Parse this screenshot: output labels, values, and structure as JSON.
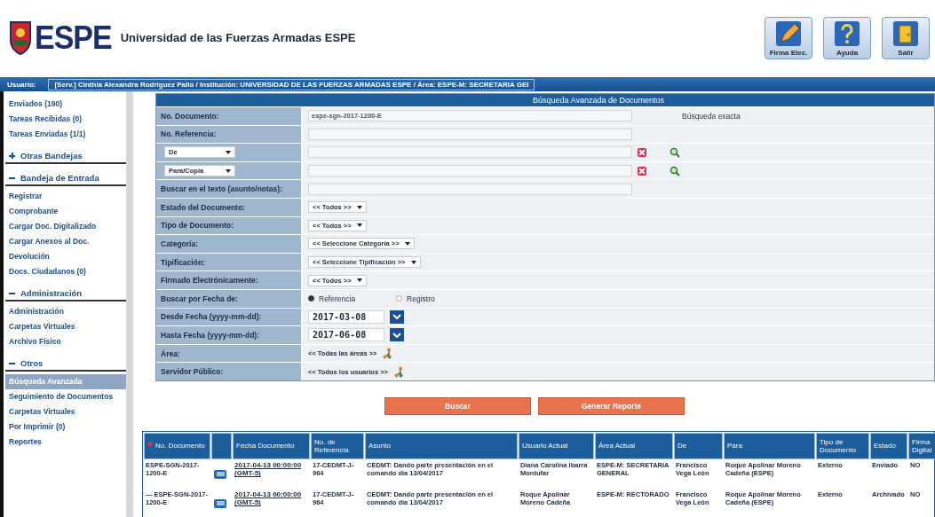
{
  "header": {
    "logo_text": "ESPE",
    "title": "Universidad de las Fuerzas Armadas ESPE",
    "buttons": [
      {
        "kind": "pencil",
        "label": "Firma Elec."
      },
      {
        "kind": "help",
        "label": "Ayuda"
      },
      {
        "kind": "exit",
        "label": "Salir"
      }
    ]
  },
  "user_bar": {
    "label": "Usuario:",
    "text": "[Serv.] Cinthia Alexandra Rodriguez Pallo / Institución: UNIVERSIDAD DE LAS FUERZAS ARMADAS ESPE / Área: ESPE-M: SECRETARIA GEI"
  },
  "sidebar": {
    "items": [
      {
        "label": "Enviados (190)",
        "selected": false
      },
      {
        "label": "Tareas Recibidas (0)",
        "selected": false
      },
      {
        "label": "Tareas Enviadas (1/1)",
        "selected": false
      }
    ],
    "sections": [
      {
        "title": "Otras Bandejas",
        "expanded": false
      },
      {
        "title": "Bandeja de Entrada",
        "expanded": true,
        "items": [
          {
            "label": "Registrar",
            "selected": false
          },
          {
            "label": "Comprobante",
            "selected": false
          },
          {
            "label": "Cargar Doc. Digitalizado",
            "selected": false
          },
          {
            "label": "Cargar Anexos al Doc.",
            "selected": false
          },
          {
            "label": "Devolución",
            "selected": false
          },
          {
            "label": "Docs. Ciudadanos (0)",
            "selected": false
          }
        ]
      },
      {
        "title": "Administración",
        "expanded": true,
        "items": [
          {
            "label": "Administración",
            "selected": false
          },
          {
            "label": "Carpetas Virtuales",
            "selected": false
          },
          {
            "label": "Archivo Físico",
            "selected": false
          }
        ]
      },
      {
        "title": "Otros",
        "expanded": true,
        "items": [
          {
            "label": "Búsqueda Avanzada",
            "selected": true
          },
          {
            "label": "Seguimiento de Documentos",
            "selected": false
          },
          {
            "label": "Carpetas Virtuales",
            "selected": false
          },
          {
            "label": "Por Imprimir (0)",
            "selected": false
          },
          {
            "label": "Reportes",
            "selected": false
          }
        ]
      }
    ]
  },
  "form": {
    "title": "Búsqueda Avanzada de Documentos",
    "rows": [
      {
        "kind": "text",
        "label": "No. Documento:",
        "value": "espe-sgn-2017-1200-E",
        "note": "Búsqueda exacta"
      },
      {
        "kind": "text",
        "label": "No. Referencia:"
      },
      {
        "kind": "picker",
        "label": "De"
      },
      {
        "kind": "picker",
        "label": "Para/Copia"
      },
      {
        "kind": "text",
        "label": "Buscar en el texto (asunto/notas):"
      },
      {
        "kind": "select",
        "label": "Estado del Documento:",
        "value": "<< Todos >>"
      },
      {
        "kind": "select",
        "label": "Tipo de Documento:",
        "value": "<< Todos >>"
      },
      {
        "kind": "select",
        "label": "Categoría:",
        "value": "<< Seleccione Categoría >>"
      },
      {
        "kind": "select",
        "label": "Tipificación:",
        "value": "<< Seleccione Tipificación >>"
      },
      {
        "kind": "select",
        "label": "Firmado Electrónicamente:",
        "value": "<< Todos >>"
      },
      {
        "kind": "radio",
        "label": "Buscar por Fecha de:",
        "options": [
          {
            "label": "Referencia",
            "selected": true
          },
          {
            "label": "Registro",
            "selected": false
          }
        ]
      },
      {
        "kind": "date",
        "label": "Desde Fecha (yyyy-mm-dd):",
        "value": "2017-03-08"
      },
      {
        "kind": "date",
        "label": "Hasta Fecha (yyyy-mm-dd):",
        "value": "2017-06-08"
      },
      {
        "kind": "tree",
        "label": "Área:",
        "value": "<< Todas las áreas >>"
      },
      {
        "kind": "tree",
        "label": "Servidor Público:",
        "value": "<< Todos los usuarios >>"
      }
    ],
    "buttons": [
      "Buscar",
      "Generar Reporte"
    ]
  },
  "table": {
    "columns": [
      "No. Documento",
      "Fecha Documento",
      "No. de Referencia",
      "Asunto",
      "Usuario Actual",
      "Área Actual",
      "De",
      "Para",
      "Tipo de Documento",
      "Estado",
      "Firma Digital"
    ],
    "rows": [
      {
        "cells": [
          "ESPE-SGN-2017-1200-E",
          "2017-04-13 00:00:00 (GMT-5)",
          "17-CEDMT-J-964",
          "CEDMT: Dando parte presentación en el comando día 13/04/2017",
          "Diana Carolina Ibarra Montufar",
          "ESPE-M: SECRETARIA GENERAL",
          "Francisco Vega León",
          "Roque Apolinar Moreno Cadeña (ESPE)",
          "Externo",
          "Enviado",
          "NO"
        ]
      },
      {
        "cells": [
          "— ESPE-SGN-2017-1200-E",
          "2017-04-13 00:00:00 (GMT-5)",
          "17-CEDMT-J-964",
          "CEDMT: Dando parte presentación en el comando día 13/04/2017",
          "Roque Apolinar Moreno Cadeña",
          "ESPE-M: RECTORADO",
          "Francisco Vega León",
          "Roque Apolinar Moreno Cadeña (ESPE)",
          "Externo",
          "Archivado",
          "NO"
        ]
      }
    ]
  }
}
